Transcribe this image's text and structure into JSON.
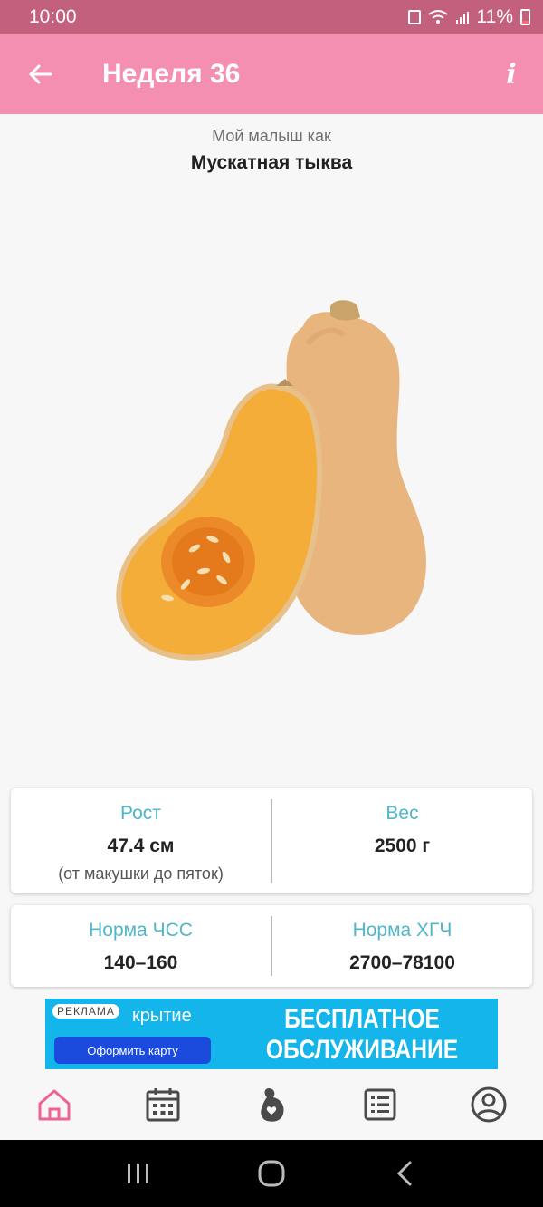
{
  "status_bar": {
    "time": "10:00",
    "battery": "11%"
  },
  "header": {
    "title": "Неделя 36",
    "info_label": "i"
  },
  "content": {
    "subtitle": "Мой малыш как",
    "fruit_name": "Мускатная тыква",
    "illustration_icon": "butternut-squash-image"
  },
  "stats": {
    "height_label": "Рост",
    "height_value": "47.4 см",
    "height_note": "(от макушки до пяток)",
    "weight_label": "Вес",
    "weight_value": "2500 г",
    "hr_label": "Норма ЧСС",
    "hr_value": "140–160",
    "hcg_label": "Норма ХГЧ",
    "hcg_value": "2700–78100"
  },
  "ad": {
    "label": "РЕКЛАМА",
    "brand": "крытие",
    "cta": "Оформить карту",
    "headline_line1": "БЕСПЛАТНОЕ",
    "headline_line2": "ОБСЛУЖИВАНИЕ"
  },
  "bottom_nav": {
    "items": [
      "home-icon",
      "calendar-icon",
      "pregnancy-icon",
      "list-icon",
      "profile-icon"
    ],
    "active_color": "#f06292",
    "inactive_color": "#4a4a4a"
  },
  "colors": {
    "status_bar": "#c2607e",
    "app_bar": "#f48fb1",
    "accent_label": "#4fb7c8",
    "ad_background": "#13b5ea"
  }
}
